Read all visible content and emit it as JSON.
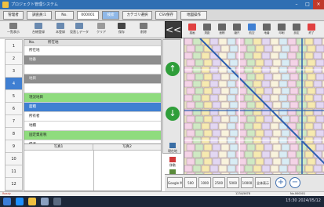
{
  "window": {
    "title": "プロジェクト管理システム"
  },
  "tabs": [
    {
      "label": "管理者",
      "style": "plain"
    },
    {
      "label": "調査員:1",
      "style": "plain"
    },
    {
      "label": "No.",
      "style": "plain"
    },
    {
      "label": "000001",
      "style": "input"
    },
    {
      "label": "検索",
      "style": "blue"
    },
    {
      "label": "カテゴリ選択",
      "style": "plain"
    },
    {
      "label": "CSV保存",
      "style": "plain"
    },
    {
      "label": "地図操作",
      "style": "plain"
    }
  ],
  "left_toolbar": [
    {
      "label": "一覧表示",
      "icon": "list-icon"
    },
    {
      "label": "台帳登録",
      "icon": "ledger-icon"
    },
    {
      "label": "本登録",
      "icon": "register-icon"
    },
    {
      "label": "見直しデータ",
      "icon": "review-icon"
    },
    {
      "label": "クリア",
      "icon": "clear-icon"
    },
    {
      "label": "保存",
      "icon": "save-icon"
    },
    {
      "label": "削除",
      "icon": "delete-icon"
    }
  ],
  "back_button": {
    "label": "<<"
  },
  "map_toolbar": [
    {
      "label": "描画",
      "icon": "draw-icon",
      "color": "#e04040"
    },
    {
      "label": "測距",
      "icon": "measure-icon",
      "color": "#666666"
    },
    {
      "label": "面積",
      "icon": "area-icon",
      "color": "#666666"
    },
    {
      "label": "縮尺",
      "icon": "scale-icon",
      "color": "#666666"
    },
    {
      "label": "航空",
      "icon": "aerial-icon",
      "color": "#3f7fd2"
    },
    {
      "label": "地番",
      "icon": "lot-icon",
      "color": "#666666"
    },
    {
      "label": "印刷",
      "icon": "print-icon",
      "color": "#666666"
    },
    {
      "label": "設定",
      "icon": "settings-icon",
      "color": "#666666"
    },
    {
      "label": "終了",
      "icon": "exit-icon",
      "color": "#e04040"
    }
  ],
  "row_numbers": [
    "1",
    "2",
    "3",
    "4",
    "5",
    "6",
    "7",
    "8",
    "9",
    "10",
    "11",
    "12"
  ],
  "selected_row": "4",
  "grid_header": {
    "col1": "No.",
    "col2": "所在地"
  },
  "grid_rows": [
    {
      "text": "所在地",
      "style": "plain"
    },
    {
      "text": "地番",
      "style": "gray"
    },
    {
      "text": "",
      "style": "plain"
    },
    {
      "text": "地目",
      "style": "gray"
    },
    {
      "text": "",
      "style": "plain"
    },
    {
      "text": "現況地目",
      "style": "green"
    },
    {
      "text": "面積",
      "style": "blue"
    },
    {
      "text": "所有者",
      "style": "plain"
    },
    {
      "text": "地積",
      "style": "plain"
    },
    {
      "text": "固定資産税",
      "style": "green"
    },
    {
      "text": "備考",
      "style": "plain"
    }
  ],
  "subgrid_header": {
    "col1": "写真1",
    "col2": "写真2"
  },
  "side_buttons": [
    {
      "label": "現在地",
      "icon": "location-icon"
    },
    {
      "label": "移動",
      "icon": "move-icon"
    },
    {
      "label": "表示切替",
      "icon": "toggle-icon"
    }
  ],
  "scale_buttons": [
    "Google Maps",
    "500",
    "1000",
    "2500",
    "5000",
    "10000",
    "全体表示"
  ],
  "status": {
    "left": "Ready",
    "center": "1234/5678",
    "right": "No.000001"
  },
  "clock": {
    "time": "15:30",
    "date": "2024/05/12"
  },
  "colors": {
    "accent": "#3f7fd2",
    "green": "#8fdc7e",
    "arrow": "#2f9e3a",
    "titlebar": "#2f6fb3"
  }
}
